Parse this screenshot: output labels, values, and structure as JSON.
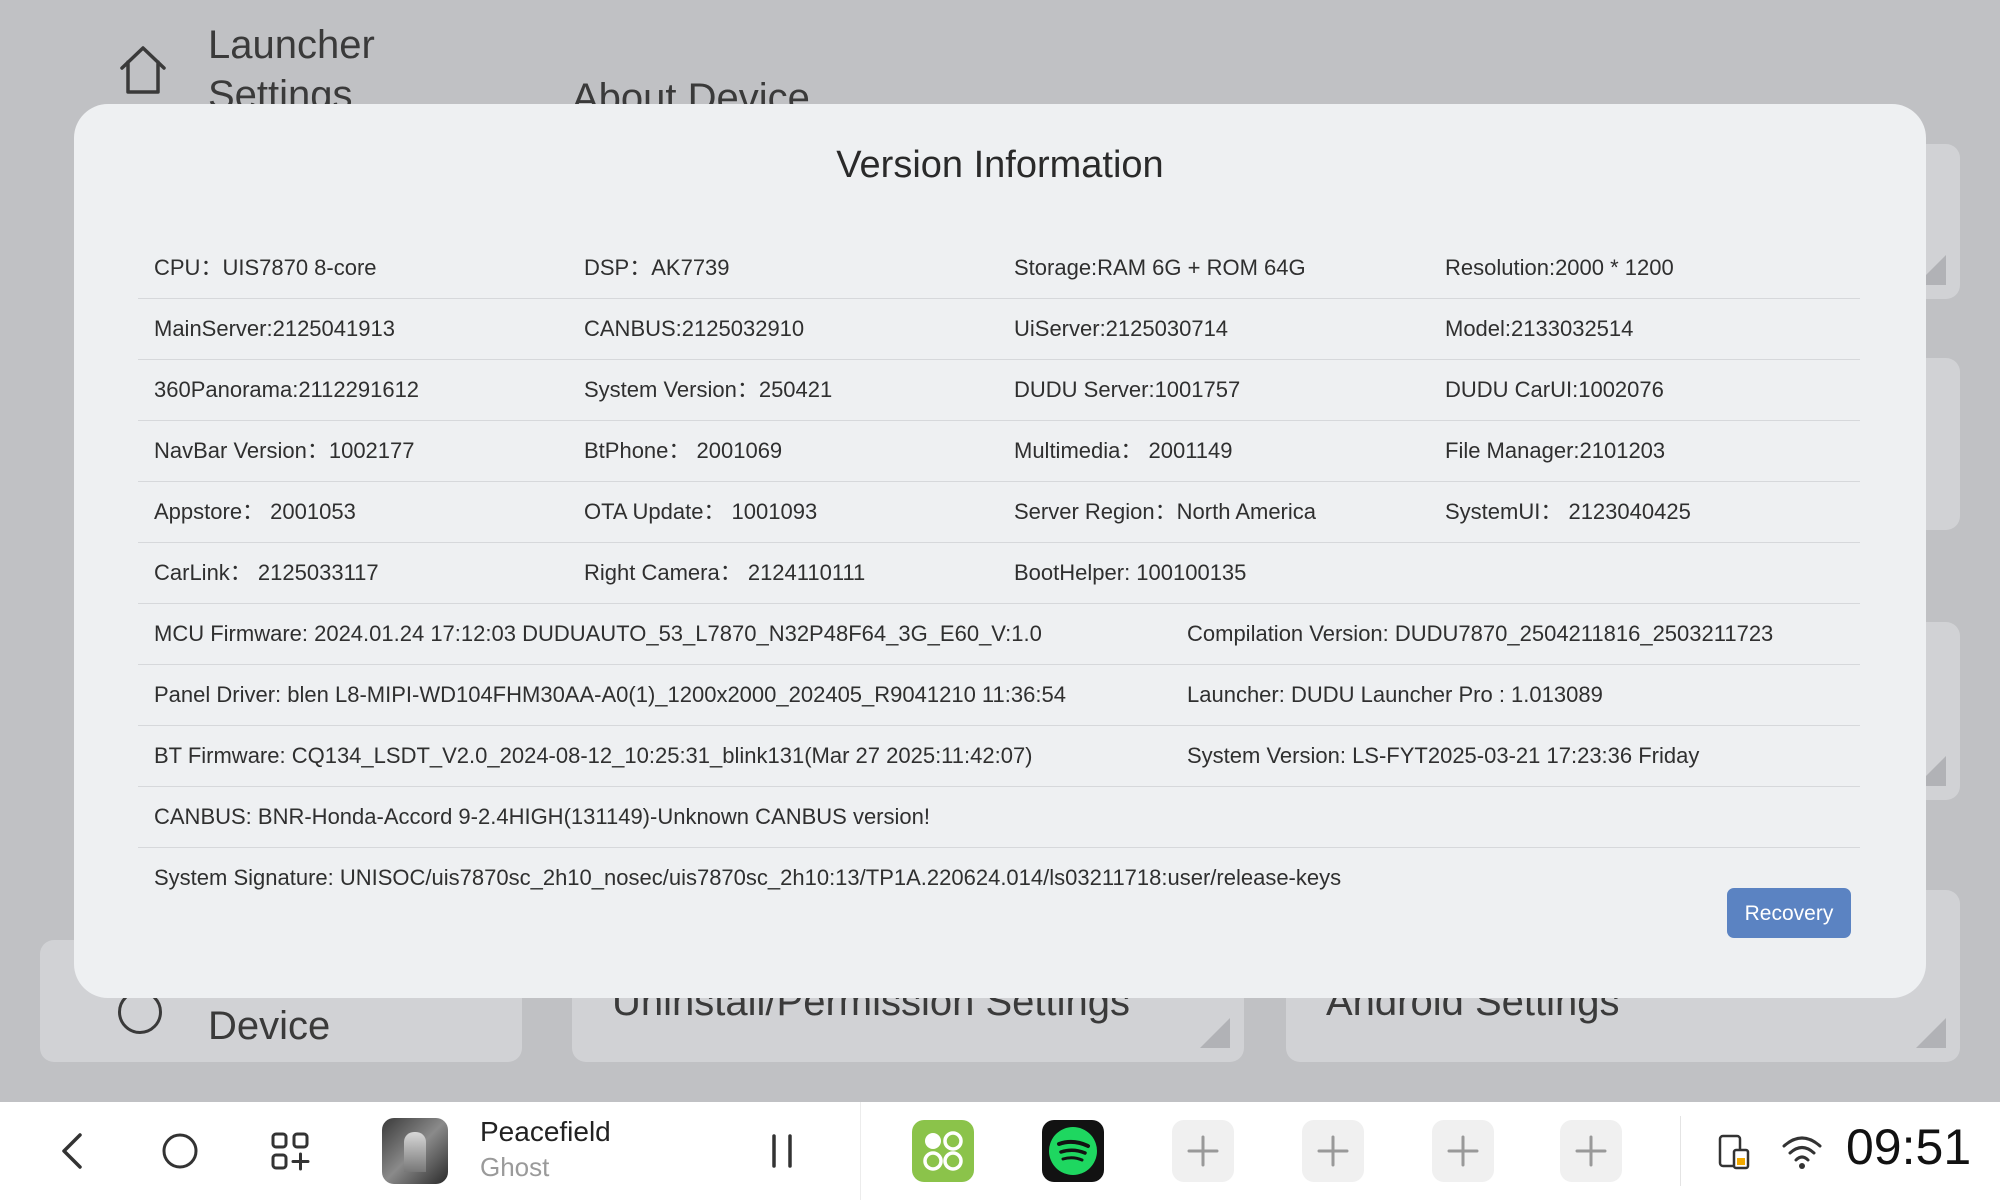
{
  "background": {
    "header_title": "Launcher Settings",
    "about_tab": "About Device",
    "cards": {
      "device": "Device",
      "uninstall": "Uninstall/Permission Settings",
      "android": "Android Settings"
    }
  },
  "modal": {
    "title": "Version Information",
    "rows4": [
      [
        "CPU：UIS7870 8-core",
        "DSP：AK7739",
        "Storage:RAM 6G + ROM 64G",
        "Resolution:2000 * 1200"
      ],
      [
        "MainServer:2125041913",
        "CANBUS:2125032910",
        "UiServer:2125030714",
        "Model:2133032514"
      ],
      [
        "360Panorama:2112291612",
        "System Version：250421",
        "DUDU Server:1001757",
        "DUDU CarUI:1002076"
      ],
      [
        "NavBar Version：1002177",
        "BtPhone：  2001069",
        "Multimedia：  2001149",
        "File Manager:2101203"
      ],
      [
        "Appstore：  2001053",
        "OTA Update：  1001093",
        "Server Region：North America",
        "SystemUI：  2123040425"
      ],
      [
        "CarLink：  2125033117",
        "Right Camera：  2124110111",
        "BootHelper: 100100135",
        ""
      ]
    ],
    "rows2": [
      [
        "MCU Firmware:  2024.01.24 17:12:03 DUDUAUTO_53_L7870_N32P48F64_3G_E60_V:1.0",
        "Compilation Version:  DUDU7870_2504211816_2503211723"
      ],
      [
        "Panel Driver:  blen L8-MIPI-WD104FHM30AA-A0(1)_1200x2000_202405_R9041210 11:36:54",
        "Launcher:  DUDU Launcher Pro : 1.013089"
      ],
      [
        "BT Firmware:  CQ134_LSDT_V2.0_2024-08-12_10:25:31_blink131(Mar 27 2025:11:42:07)",
        "System Version:  LS-FYT2025-03-21 17:23:36 Friday"
      ]
    ],
    "rows1": [
      "CANBUS:  BNR-Honda-Accord 9-2.4HIGH(131149)-Unknown CANBUS version!",
      "System Signature:  UNISOC/uis7870sc_2h10_nosec/uis7870sc_2h10:13/TP1A.220624.014/ls03211718:user/release-keys"
    ],
    "recovery_label": "Recovery"
  },
  "navbar": {
    "media_title": "Peacefield",
    "media_artist": "Ghost",
    "clock": "09:51",
    "icons": [
      "back-icon",
      "home-circle-icon",
      "apps-grid-icon",
      "pause-icon",
      "app-launcher-icon",
      "spotify-icon",
      "plus-icon",
      "device-battery-icon",
      "wifi-icon"
    ],
    "colors": {
      "launcher_green": "#8bc34a",
      "spotify_green": "#1ed760",
      "accent_blue": "#5b83c2"
    }
  }
}
